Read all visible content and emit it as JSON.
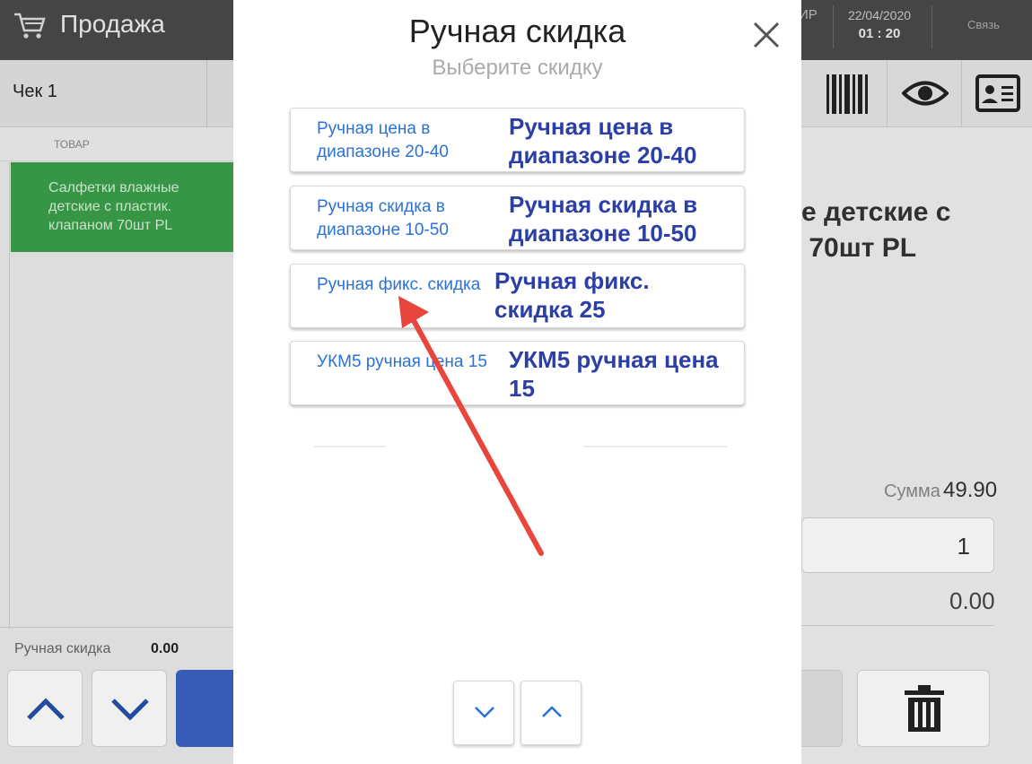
{
  "topbar": {
    "app_title": "Продажа",
    "right_code": "ИР",
    "date": "22/04/2020",
    "time": "01 : 20",
    "link": "Связь"
  },
  "left": {
    "tab_label": "Чек 1",
    "column_header": "ТОВАР",
    "item_name": "Салфетки влажные детские с пластик. клапаном 70шт PL",
    "summary_label": "Ручная скидка",
    "summary_value": "0.00"
  },
  "right": {
    "product_name": "е детские с\n 70шт PL",
    "sum_label": "Сумма",
    "sum_value": "49.90",
    "quantity": "1",
    "discount_value": "0.00"
  },
  "modal": {
    "title": "Ручная скидка",
    "subtitle": "Выберите скидку",
    "options": [
      {
        "label": "Ручная цена в диапазоне 20-40",
        "overlay": "Ручная цена в диапазоне 20-40"
      },
      {
        "label": "Ручная скидка в диапазоне 10-50",
        "overlay": "Ручная скидка в диапазоне 10-50"
      },
      {
        "label": "Ручная фикс. скидка",
        "overlay": "Ручная фикс. скидка 25"
      },
      {
        "label": "УКМ5 ручная цена 15",
        "overlay": "УКМ5 ручная цена 15"
      }
    ]
  },
  "colors": {
    "accent_blue": "#2a72d8",
    "overlay_text": "#2b3fa5",
    "selected_row": "#3aa04a",
    "annotation_arrow": "#e8453c",
    "topbar": "#4a4a4a"
  },
  "icons": [
    "cart-icon",
    "barcode-icon",
    "eye-icon",
    "id-card-icon",
    "close-icon",
    "chevron-up-icon",
    "chevron-down-icon",
    "trash-icon"
  ]
}
